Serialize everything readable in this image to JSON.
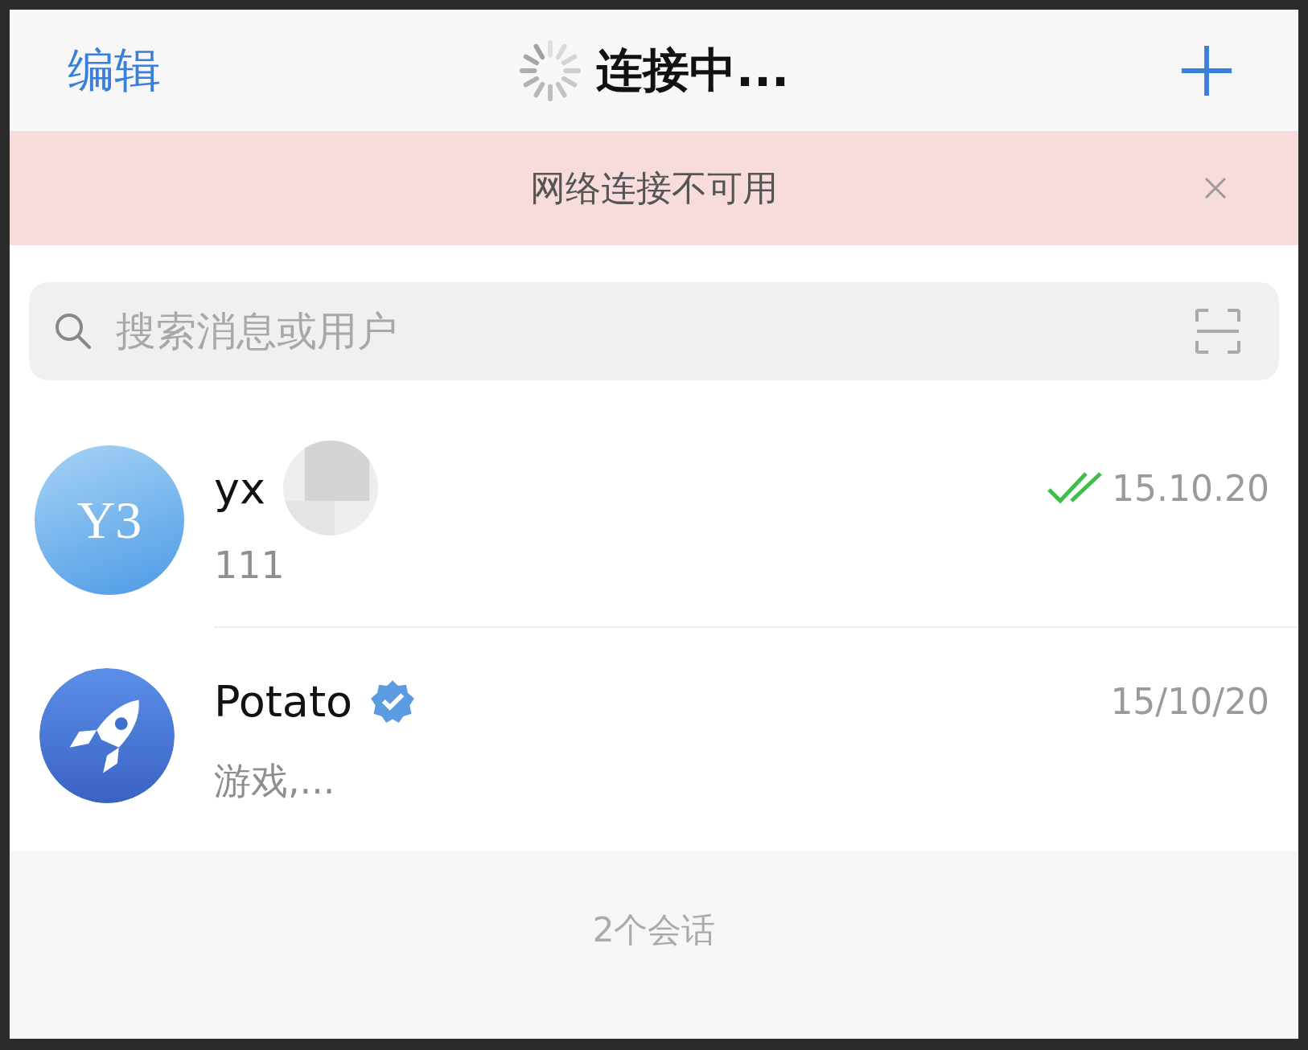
{
  "header": {
    "edit_label": "编辑",
    "title": "连接中...",
    "loading": true
  },
  "banner": {
    "text": "网络连接不可用"
  },
  "search": {
    "placeholder": "搜索消息或用户"
  },
  "chats": [
    {
      "name": "yx",
      "avatar": {
        "kind": "initials",
        "text": "Y3"
      },
      "verified": false,
      "read": true,
      "time": "15.10.20",
      "preview": "111"
    },
    {
      "name": "Potato",
      "avatar": {
        "kind": "rocket"
      },
      "verified": true,
      "read": false,
      "time": "15/10/20",
      "preview": "游戏,..."
    }
  ],
  "footer": {
    "count": "2个会话"
  }
}
